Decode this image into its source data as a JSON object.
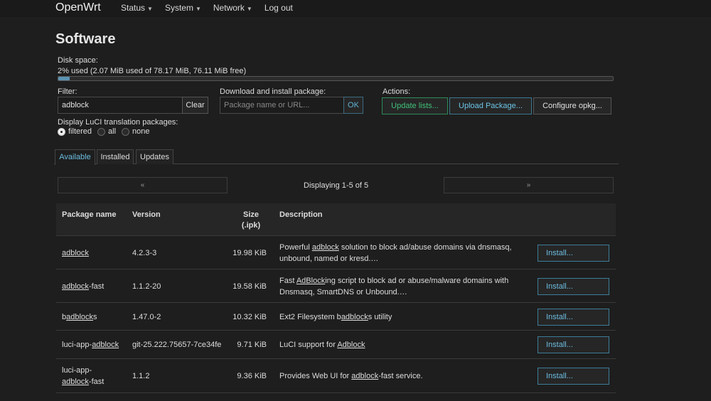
{
  "nav": {
    "brand": "OpenWrt",
    "items": [
      {
        "label": "Status",
        "dropdown": true
      },
      {
        "label": "System",
        "dropdown": true
      },
      {
        "label": "Network",
        "dropdown": true
      },
      {
        "label": "Log out",
        "dropdown": false
      }
    ]
  },
  "page": {
    "title": "Software"
  },
  "disk": {
    "label": "Disk space:",
    "text": "2% used (2.07 MiB used of 78.17 MiB, 76.11 MiB free)",
    "percent": 2
  },
  "filter": {
    "label": "Filter:",
    "value": "adblock",
    "clear_label": "Clear"
  },
  "download": {
    "label": "Download and install package:",
    "placeholder": "Package name or URL...",
    "ok_label": "OK"
  },
  "actions": {
    "label": "Actions:",
    "update_lists": "Update lists...",
    "upload_package": "Upload Package...",
    "configure_opkg": "Configure opkg..."
  },
  "translation": {
    "label": "Display LuCI translation packages:",
    "options": [
      "filtered",
      "all",
      "none"
    ],
    "selected": "filtered"
  },
  "tabs": [
    {
      "label": "Available",
      "active": true
    },
    {
      "label": "Installed",
      "active": false
    },
    {
      "label": "Updates",
      "active": false
    }
  ],
  "pager": {
    "prev": "«",
    "next": "»",
    "status": "Displaying 1-5 of 5"
  },
  "table": {
    "headers": {
      "name": "Package name",
      "version": "Version",
      "size": "Size",
      "size_unit": "(.ipk)",
      "description": "Description"
    },
    "install_label": "Install...",
    "rows": [
      {
        "name_parts": [
          {
            "text": "adblock",
            "u": true
          }
        ],
        "version": "4.2.3-3",
        "size": "19.98 KiB",
        "desc_lines": [
          [
            {
              "text": "Powerful ",
              "u": false
            },
            {
              "text": "adblock",
              "u": true
            },
            {
              "text": " solution to block ad/abuse domains via dnsmasq,",
              "u": false
            }
          ],
          [
            {
              "text": "unbound, named or kresd.…",
              "u": false
            }
          ]
        ]
      },
      {
        "name_parts": [
          {
            "text": "adblock",
            "u": true
          },
          {
            "text": "-fast",
            "u": false
          }
        ],
        "version": "1.1.2-20",
        "size": "19.58 KiB",
        "desc_lines": [
          [
            {
              "text": "Fast ",
              "u": false
            },
            {
              "text": "AdBlock",
              "u": true
            },
            {
              "text": "ing script to block ad or abuse/malware domains with",
              "u": false
            }
          ],
          [
            {
              "text": "Dnsmasq, SmartDNS or Unbound.…",
              "u": false
            }
          ]
        ]
      },
      {
        "name_parts": [
          {
            "text": "b",
            "u": false
          },
          {
            "text": "adblock",
            "u": true
          },
          {
            "text": "s",
            "u": false
          }
        ],
        "version": "1.47.0-2",
        "size": "10.32 KiB",
        "desc_lines": [
          [
            {
              "text": "Ext2 Filesystem b",
              "u": false
            },
            {
              "text": "adblock",
              "u": true
            },
            {
              "text": "s utility",
              "u": false
            }
          ]
        ]
      },
      {
        "name_parts": [
          {
            "text": "luci-app-",
            "u": false
          },
          {
            "text": "adblock",
            "u": true
          }
        ],
        "version": "git-25.222.75657-7ce34fe",
        "size": "9.71 KiB",
        "desc_lines": [
          [
            {
              "text": "LuCI support for ",
              "u": false
            },
            {
              "text": "Adblock",
              "u": true
            }
          ]
        ]
      },
      {
        "name_lines": [
          [
            {
              "text": "luci-app-",
              "u": false
            }
          ],
          [
            {
              "text": "adblock",
              "u": true
            },
            {
              "text": "-fast",
              "u": false
            }
          ]
        ],
        "version": "1.1.2",
        "size": "9.36 KiB",
        "desc_lines": [
          [
            {
              "text": "Provides Web UI for ",
              "u": false
            },
            {
              "text": "adblock",
              "u": true
            },
            {
              "text": "-fast service.",
              "u": false
            }
          ]
        ]
      }
    ]
  }
}
